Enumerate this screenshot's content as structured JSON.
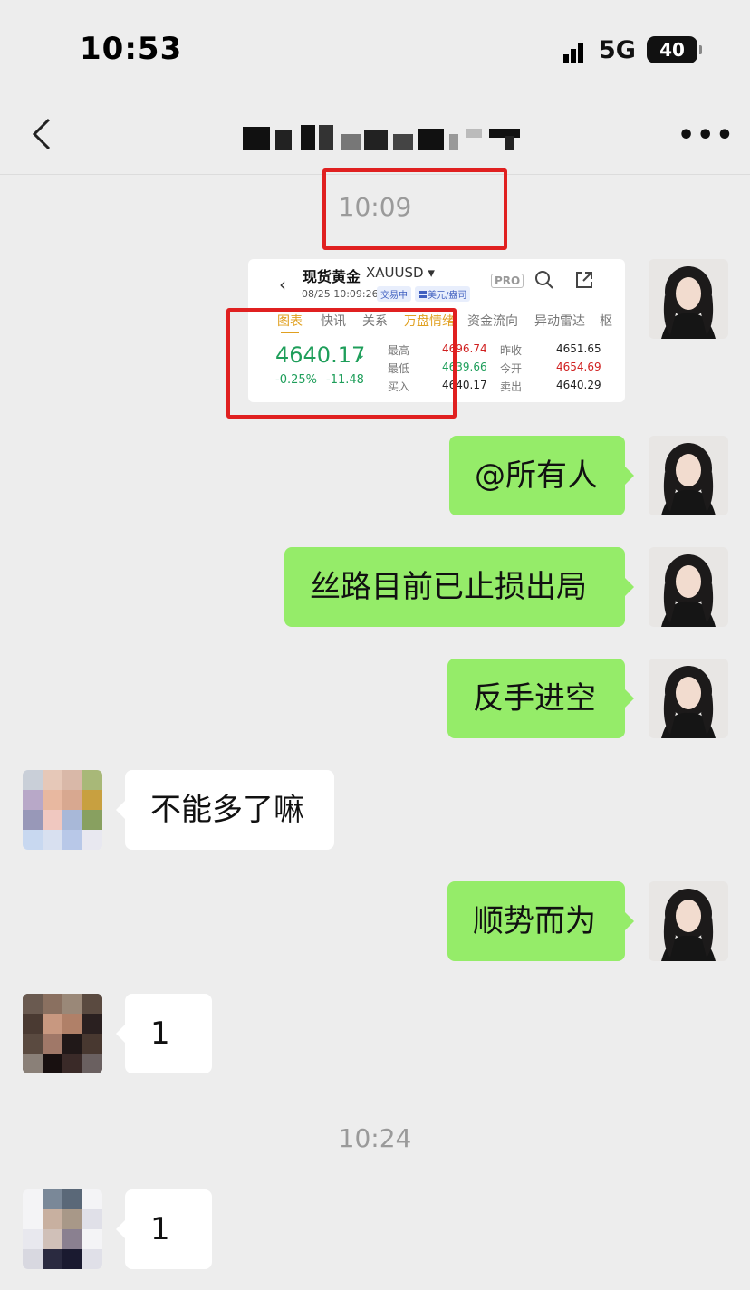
{
  "status_bar": {
    "time": "10:53",
    "network": "5G",
    "battery": "40"
  },
  "nav": {
    "back_icon": "chevron-left-icon",
    "more_label": "•••"
  },
  "timestamps": [
    "10:09",
    "10:24"
  ],
  "shared_image": {
    "name": "现货黄金",
    "symbol": "XAUUSD ▾",
    "datetime": "08/25 10:09:26",
    "tag_trading": "交易中",
    "tag_unit": "〓美元/盎司",
    "pro": "PRO",
    "tabs": [
      "图表",
      "快讯",
      "关系",
      "万盘情绪",
      "资金流向",
      "异动雷达",
      "枢"
    ],
    "price": "4640.17",
    "change_pct": "-0.25%",
    "change_abs": "-11.48",
    "labels": [
      "最高",
      "最低",
      "买入",
      "昨收",
      "今开",
      "卖出"
    ],
    "values": [
      "4696.74",
      "4639.66",
      "4640.17",
      "4651.65",
      "4654.69",
      "4640.29"
    ]
  },
  "messages": [
    {
      "side": "right",
      "text": "@所有人"
    },
    {
      "side": "right",
      "text": "丝路目前已止损出局"
    },
    {
      "side": "right",
      "text": "反手进空"
    },
    {
      "side": "left",
      "text": "不能多了嘛"
    },
    {
      "side": "right",
      "text": "顺势而为"
    },
    {
      "side": "left",
      "text": "1"
    },
    {
      "side": "left",
      "text": "1"
    }
  ],
  "colors": {
    "background": "#ededed",
    "bubble_self": "#95ec69",
    "bubble_other": "#ffffff",
    "highlight_box": "#e02020"
  }
}
